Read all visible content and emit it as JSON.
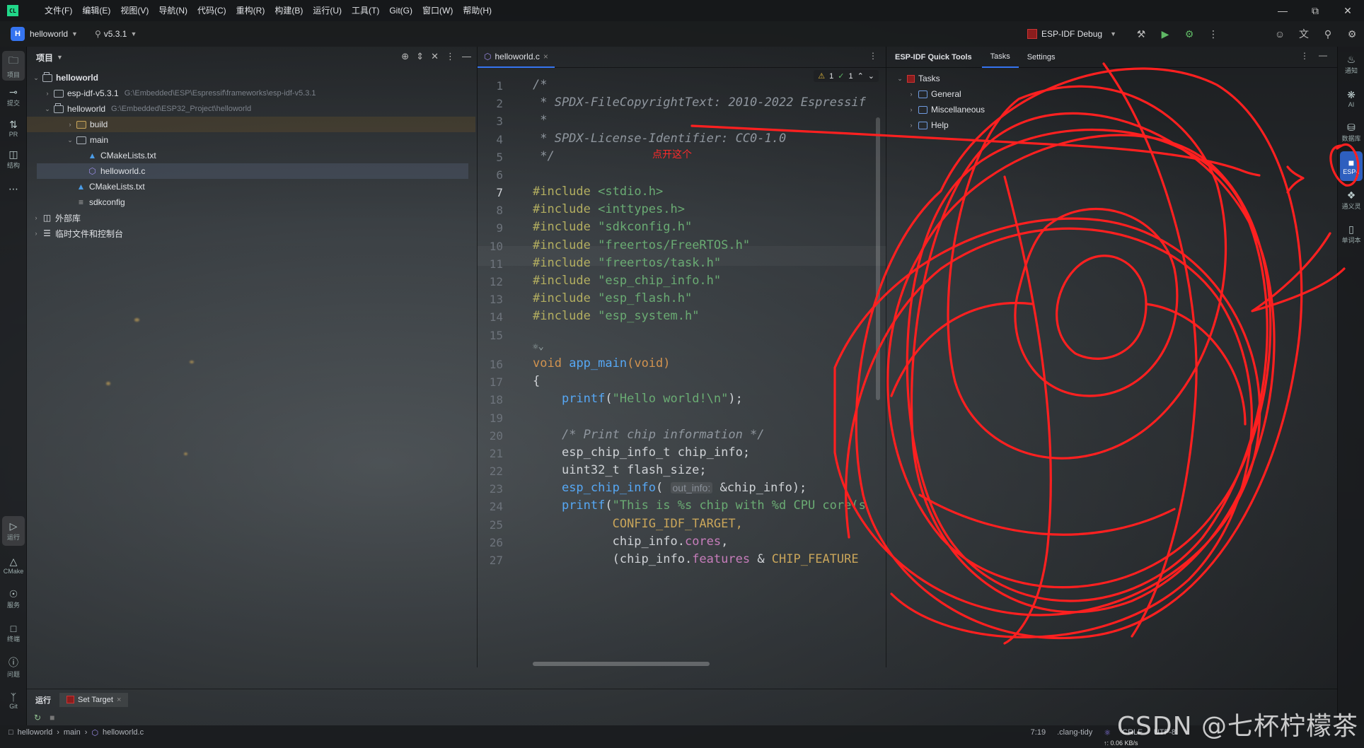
{
  "menubar": {
    "logo_text": "CL",
    "items": [
      "文件(F)",
      "编辑(E)",
      "视图(V)",
      "导航(N)",
      "代码(C)",
      "重构(R)",
      "构建(B)",
      "运行(U)",
      "工具(T)",
      "Git(G)",
      "窗口(W)",
      "帮助(H)"
    ]
  },
  "toolbar": {
    "project_initial": "H",
    "project_name": "helloworld",
    "branch": "v5.3.1",
    "run_config": "ESP-IDF Debug"
  },
  "left_stripe": {
    "project": "项目",
    "commit": "提交",
    "pr": "PR",
    "structure": "结构",
    "run": "运行",
    "cmake": "CMake",
    "services": "服务",
    "terminal": "终端",
    "problems": "问题",
    "git": "Git"
  },
  "right_stripe": {
    "notifications": "通知",
    "ai": "AI",
    "database": "数据库",
    "esp": "ESP-I",
    "translate": "通义灵",
    "word": "单词本"
  },
  "project_panel": {
    "title": "项目",
    "tree": [
      {
        "label": "helloworld",
        "path": ""
      },
      {
        "label": "esp-idf-v5.3.1",
        "path": "G:\\Embedded\\ESP\\Espressif\\frameworks\\esp-idf-v5.3.1"
      },
      {
        "label": "helloworld",
        "path": "G:\\Embedded\\ESP32_Project\\helloworld"
      },
      {
        "label": "build",
        "path": ""
      },
      {
        "label": "main",
        "path": ""
      },
      {
        "label": "CMakeLists.txt",
        "path": ""
      },
      {
        "label": "helloworld.c",
        "path": ""
      },
      {
        "label": "CMakeLists.txt",
        "path": ""
      },
      {
        "label": "sdkconfig",
        "path": ""
      },
      {
        "label": "外部库",
        "path": ""
      },
      {
        "label": "临时文件和控制台",
        "path": ""
      }
    ]
  },
  "editor": {
    "tab_label": "helloworld.c",
    "inspections": {
      "warnings": "1",
      "ok": "1"
    },
    "line_numbers": [
      "1",
      "2",
      "3",
      "4",
      "5",
      "6",
      "7",
      "8",
      "9",
      "10",
      "11",
      "12",
      "13",
      "14",
      "15",
      "16",
      "17",
      "18",
      "19",
      "20",
      "21",
      "22",
      "23",
      "24",
      "25",
      "26",
      "27"
    ],
    "lines": {
      "l1": "/*",
      "l2": " * SPDX-FileCopyrightText: 2010-2022 Espressif",
      "l3": " *",
      "l4": " * SPDX-License-Identifier: CC0-1.0",
      "l5": " */",
      "inc_kw": "#include",
      "inc7": "<stdio.h>",
      "inc8": "<inttypes.h>",
      "inc9": "\"sdkconfig.h\"",
      "inc10": "\"freertos/FreeRTOS.h\"",
      "inc11": "\"freertos/task.h\"",
      "inc12": "\"esp_chip_info.h\"",
      "inc13": "\"esp_flash.h\"",
      "inc14": "\"esp_system.h\"",
      "void": "void",
      "app_main": "app_main",
      "paren_void": "(void)",
      "brace": "{",
      "printf": "printf",
      "hello_str": "\"Hello world!\\n\"",
      "hello_tail": ");",
      "comment20": "/* Print chip information */",
      "l21": "esp_chip_info_t chip_info;",
      "l22": "uint32_t flash_size;",
      "esp_chip_info": "esp_chip_info",
      "hint": "out_info:",
      "l23tail": "&chip_info);",
      "str24": "\"This is %s chip with %d CPU core(s",
      "l25": "CONFIG_IDF_TARGET,",
      "l26a": "chip_info.",
      "l26b": "cores",
      "l26c": ",",
      "l27a": "(chip_info.",
      "l27b": "features",
      "l27c": " & ",
      "l27d": "CHIP_FEATURE"
    },
    "annotation": "点开这个"
  },
  "esp_panel": {
    "title": "ESP-IDF Quick Tools",
    "tabs": [
      "Tasks",
      "Settings"
    ],
    "tree": [
      "Tasks",
      "General",
      "Miscellaneous",
      "Help"
    ]
  },
  "bottom": {
    "tabs": [
      "运行",
      "Set Target"
    ]
  },
  "statusbar": {
    "breadcrumb": [
      "helloworld",
      "main",
      "helloworld.c"
    ],
    "position": "7:19",
    "linter": ".clang-tidy",
    "line_sep": "CRLF",
    "encoding": "UTF-8",
    "net": "↑: 0.06 KB/s"
  },
  "watermark": "CSDN @七杯柠檬茶",
  "colors": {
    "accent": "#3574f0",
    "scribble": "#ff2020",
    "keyword": "#d2934f",
    "string": "#6aab73"
  }
}
